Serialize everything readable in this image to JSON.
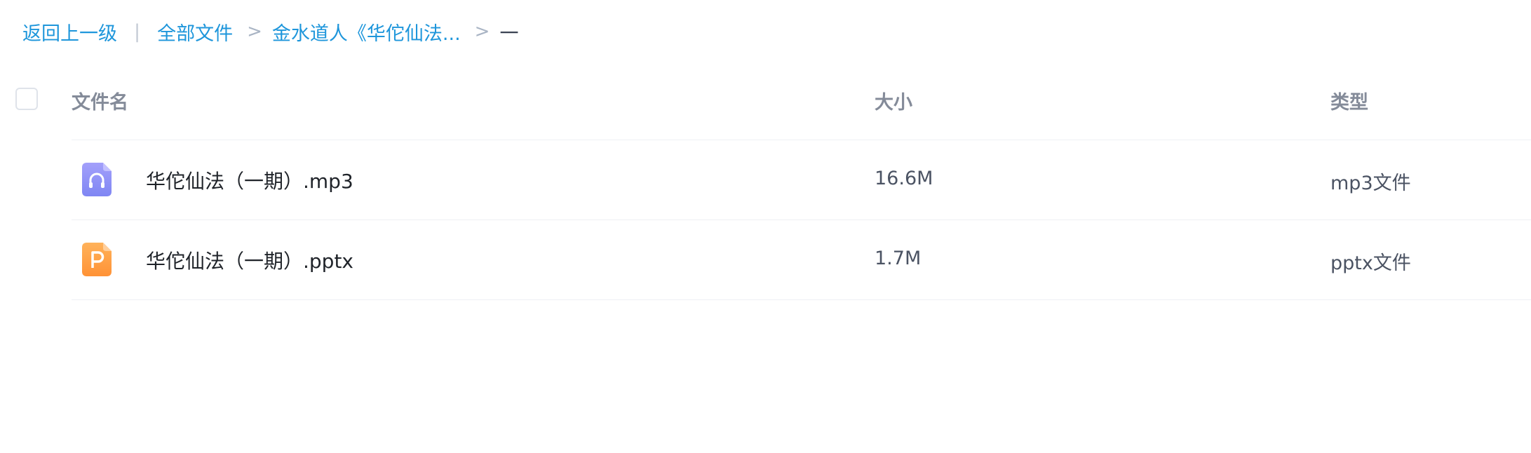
{
  "breadcrumb": {
    "back_label": "返回上一级",
    "pipe": "|",
    "root_label": "全部文件",
    "separator": ">",
    "folder_label": "金水道人《华佗仙法...",
    "current_label": "一"
  },
  "table": {
    "columns": {
      "name": "文件名",
      "size": "大小",
      "type": "类型"
    },
    "rows": [
      {
        "icon": "audio-file-icon",
        "icon_color": "#8c8cf5",
        "name": "华佗仙法（一期）.mp3",
        "size": "16.6M",
        "type": "mp3文件"
      },
      {
        "icon": "ppt-file-icon",
        "icon_color": "#ff9f45",
        "name": "华佗仙法（一期）.pptx",
        "size": "1.7M",
        "type": "pptx文件"
      }
    ]
  },
  "colors": {
    "link": "#1e96db",
    "header_text": "#848b99",
    "divider": "#eef0f4"
  }
}
